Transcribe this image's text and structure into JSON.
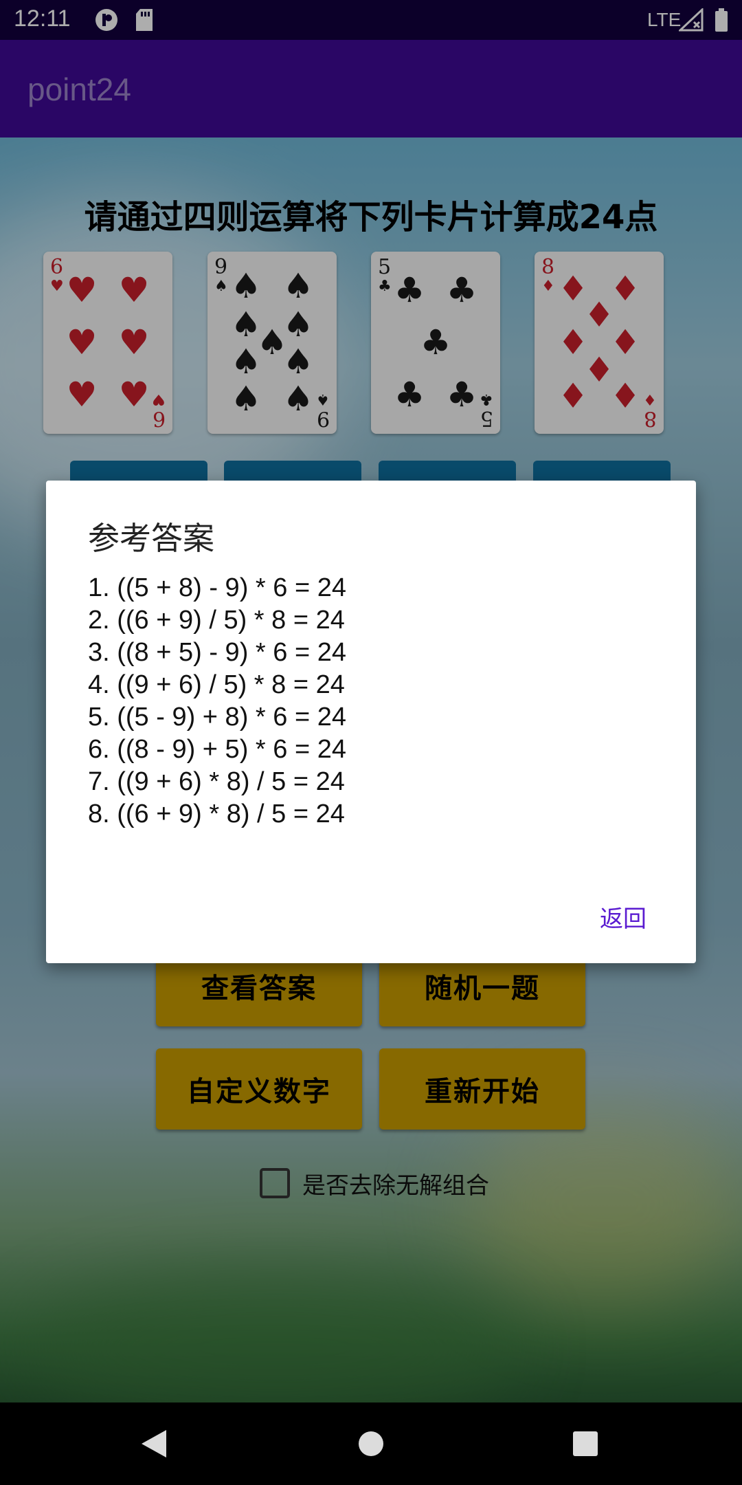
{
  "status_bar": {
    "time": "12:11",
    "network": "LTE"
  },
  "app_bar": {
    "title": "point24"
  },
  "instruction": "请通过四则运算将下列卡片计算成24点",
  "cards": [
    {
      "rank": "6",
      "suit": "hearts",
      "symbol": "♥",
      "color": "#c8202c"
    },
    {
      "rank": "9",
      "suit": "spades",
      "symbol": "♠",
      "color": "#1a1a1a"
    },
    {
      "rank": "5",
      "suit": "clubs",
      "symbol": "♣",
      "color": "#1a1a1a"
    },
    {
      "rank": "8",
      "suit": "diamonds",
      "symbol": "♦",
      "color": "#c8202c"
    }
  ],
  "buttons": {
    "show_answer": "查看答案",
    "random": "随机一题",
    "custom": "自定义数字",
    "restart": "重新开始"
  },
  "checkbox": {
    "label": "是否去除无解组合",
    "checked": false
  },
  "dialog": {
    "title": "参考答案",
    "answers": [
      "1. ((5 + 8) - 9) * 6 = 24",
      "2. ((6 + 9) / 5) * 8 = 24",
      "3. ((8 + 5) - 9) * 6 = 24",
      "4. ((9 + 6) / 5) * 8 = 24",
      "5. ((5 - 9) + 8) * 6 = 24",
      "6. ((8 - 9) + 5) * 6 = 24",
      "7. ((9 + 6) * 8) / 5 = 24",
      "8. ((6 + 9) * 8) / 5 = 24"
    ],
    "back_label": "返回"
  },
  "colors": {
    "status_bar": "#13003d",
    "app_bar": "#3e0a96",
    "action_button": "#c79b00",
    "dialog_accent": "#5a1bd1"
  }
}
